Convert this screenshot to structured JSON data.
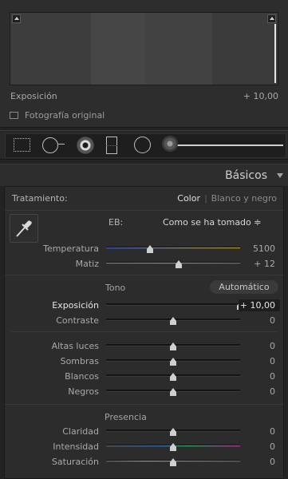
{
  "histogram": {
    "label": "Exposición",
    "value": "+ 10,00",
    "original_photo_label": "Fotografía original",
    "original_photo_checked": false
  },
  "toolbar": {
    "tools": [
      "crop-overlay-icon",
      "spot-removal-icon",
      "red-eye-icon",
      "graduated-filter-icon",
      "radial-filter-icon",
      "adjustment-brush-icon"
    ]
  },
  "basic": {
    "title": "Básicos",
    "treatment_label": "Tratamiento:",
    "treatment_color": "Color",
    "treatment_separator": "|",
    "treatment_bw": "Blanco y negro",
    "wb_label": "EB:",
    "wb_value": "Como se ha tomado ≑",
    "tone_title": "Tono",
    "auto_label": "Automático",
    "presence_title": "Presencia",
    "sliders": {
      "temperature": {
        "label": "Temperatura",
        "value": "5100",
        "level": 0.33
      },
      "tint": {
        "label": "Matiz",
        "value": "+ 12",
        "level": 0.54
      },
      "exposure": {
        "label": "Exposición",
        "value": "+ 10,00",
        "level": 1.0
      },
      "contrast": {
        "label": "Contraste",
        "value": "0",
        "level": 0.5
      },
      "highlights": {
        "label": "Altas luces",
        "value": "0",
        "level": 0.5
      },
      "shadows": {
        "label": "Sombras",
        "value": "0",
        "level": 0.5
      },
      "whites": {
        "label": "Blancos",
        "value": "0",
        "level": 0.5
      },
      "blacks": {
        "label": "Negros",
        "value": "0",
        "level": 0.5
      },
      "clarity": {
        "label": "Claridad",
        "value": "0",
        "level": 0.5
      },
      "vibrance": {
        "label": "Intensidad",
        "value": "0",
        "level": 0.5
      },
      "saturation": {
        "label": "Saturación",
        "value": "0",
        "level": 0.5
      }
    }
  }
}
